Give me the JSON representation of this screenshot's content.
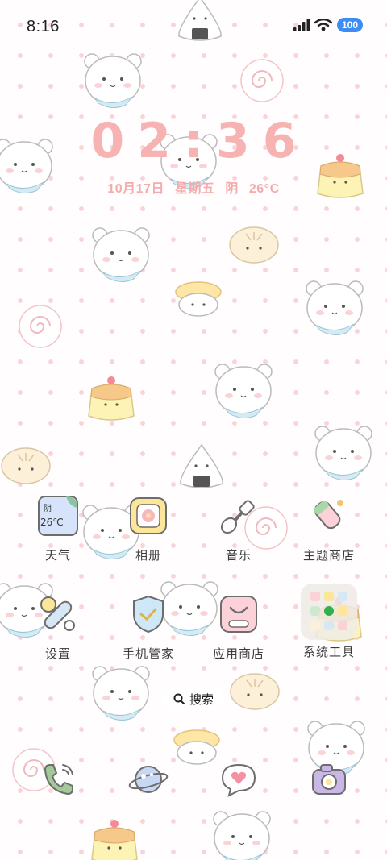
{
  "status_bar": {
    "time": "8:16",
    "battery_level": "100",
    "signal_icon": "cellular-signal-icon",
    "wifi_icon": "wifi-icon"
  },
  "clock": {
    "time": "02:36",
    "date": "10月17日",
    "weekday": "星期五",
    "weather": "阴",
    "temperature": "26°C"
  },
  "apps": {
    "row1": [
      {
        "label": "天气",
        "icon": "weather-icon",
        "widget_condition": "阴",
        "widget_temp": "26℃"
      },
      {
        "label": "相册",
        "icon": "gallery-icon"
      },
      {
        "label": "音乐",
        "icon": "music-guitar-icon"
      },
      {
        "label": "主题商店",
        "icon": "theme-store-icon"
      }
    ],
    "row2": [
      {
        "label": "设置",
        "icon": "settings-icon"
      },
      {
        "label": "手机管家",
        "icon": "phone-manager-shield-icon"
      },
      {
        "label": "应用商店",
        "icon": "app-store-icon"
      },
      {
        "label": "系统工具",
        "icon": "system-tools-folder-icon"
      }
    ]
  },
  "search": {
    "label": "搜索",
    "icon": "search-icon"
  },
  "dock": [
    {
      "icon": "phone-icon"
    },
    {
      "icon": "browser-planet-icon"
    },
    {
      "icon": "messages-heart-icon"
    },
    {
      "icon": "camera-icon"
    }
  ],
  "colors": {
    "accent_pink": "#f7b2b2",
    "battery_blue": "#3d8cf5"
  }
}
